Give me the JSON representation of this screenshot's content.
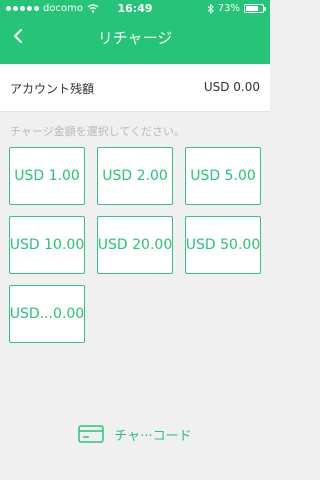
{
  "status_bar": {
    "carrier": "docomo",
    "time": "16:49",
    "battery": "73%",
    "battery_level": 0.73
  },
  "nav": {
    "title": "リチャージ",
    "back_icon": "chevron-left-icon"
  },
  "balance": {
    "label": "アカウント残額",
    "value": "USD 0.00"
  },
  "hint": "チャージ金額を選択してください。",
  "amounts": [
    "USD 1.00",
    "USD 2.00",
    "USD 5.00",
    "USD 10.00",
    "USD 20.00",
    "USD 50.00",
    "USD...0.00"
  ],
  "card_link": {
    "label": "チャ···コード",
    "icon": "card-icon"
  },
  "colors": {
    "accent": "#26c479",
    "background": "#f0f0f0"
  }
}
